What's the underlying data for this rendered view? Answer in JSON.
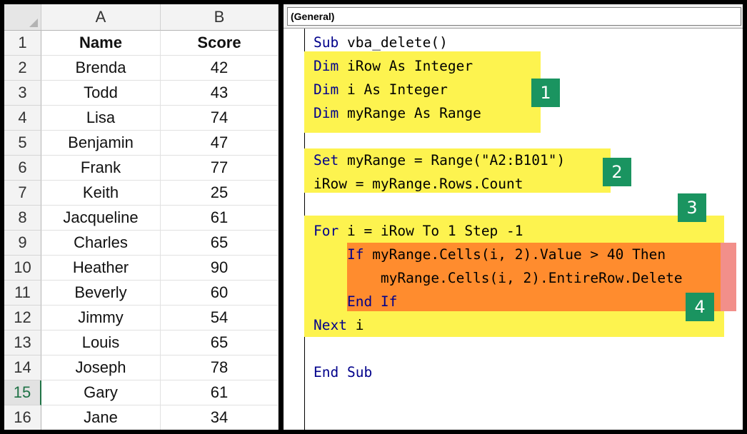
{
  "sheet": {
    "columns": [
      "A",
      "B"
    ],
    "header": {
      "row": "1",
      "name": "Name",
      "score": "Score"
    },
    "rows": [
      {
        "num": "2",
        "name": "Brenda",
        "score": "42"
      },
      {
        "num": "3",
        "name": "Todd",
        "score": "43"
      },
      {
        "num": "4",
        "name": "Lisa",
        "score": "74"
      },
      {
        "num": "5",
        "name": "Benjamin",
        "score": "47"
      },
      {
        "num": "6",
        "name": "Frank",
        "score": "77"
      },
      {
        "num": "7",
        "name": "Keith",
        "score": "25"
      },
      {
        "num": "8",
        "name": "Jacqueline",
        "score": "61"
      },
      {
        "num": "9",
        "name": "Charles",
        "score": "65"
      },
      {
        "num": "10",
        "name": "Heather",
        "score": "90"
      },
      {
        "num": "11",
        "name": "Beverly",
        "score": "60"
      },
      {
        "num": "12",
        "name": "Jimmy",
        "score": "54"
      },
      {
        "num": "13",
        "name": "Louis",
        "score": "65"
      },
      {
        "num": "14",
        "name": "Joseph",
        "score": "78"
      },
      {
        "num": "15",
        "name": "Gary",
        "score": "61"
      },
      {
        "num": "16",
        "name": "Jane",
        "score": "34"
      }
    ],
    "active_row": "15"
  },
  "editor": {
    "procedure_dropdown": "(General)",
    "lines": [
      {
        "kw": "Sub",
        "rest": " vba_delete()"
      },
      {
        "kw": "Dim",
        "rest": " iRow As Integer"
      },
      {
        "kw": "Dim",
        "rest": " i As Integer"
      },
      {
        "kw": "Dim",
        "rest": " myRange As Range"
      },
      {
        "kw": "",
        "rest": ""
      },
      {
        "kw": "Set",
        "rest": " myRange = Range(\"A2:B101\")"
      },
      {
        "kw": "",
        "rest": "iRow = myRange.Rows.Count"
      },
      {
        "kw": "",
        "rest": ""
      },
      {
        "kw": "For",
        "rest": " i = iRow To 1 Step -1"
      },
      {
        "kw": "    If",
        "rest": " myRange.Cells(i, 2).Value > 40 Then"
      },
      {
        "kw": "",
        "rest": "        myRange.Cells(i, 2).EntireRow.Delete"
      },
      {
        "kw": "    End If",
        "rest": ""
      },
      {
        "kw": "Next",
        "rest": " i"
      },
      {
        "kw": "",
        "rest": ""
      },
      {
        "kw": "End Sub",
        "rest": ""
      }
    ],
    "badges": [
      "1",
      "2",
      "3",
      "4"
    ]
  },
  "colors": {
    "highlight_yellow": "#fdf34f",
    "highlight_orange": "#ff8c2e",
    "badge_green": "#1a9460",
    "keyword_blue": "#00008b"
  }
}
